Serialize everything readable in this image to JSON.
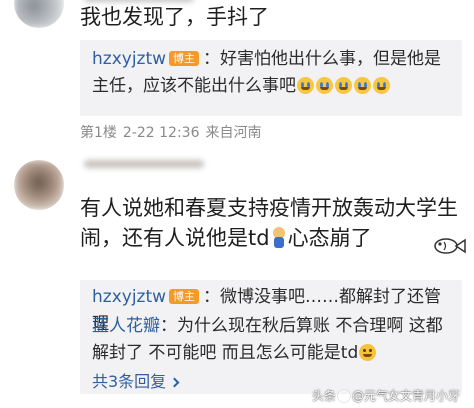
{
  "comment_1": {
    "text": "我也发现了，手抖了",
    "reply": {
      "username": "hzxyjztw",
      "badge": "博主",
      "text": "：好害怕他出什么事，但是他是主任，应该不能出什么事吧",
      "emojis": [
        "cry-emoji",
        "cry-emoji",
        "cry-emoji",
        "cry-emoji",
        "cry-emoji"
      ]
    },
    "meta": {
      "floor": "第1楼",
      "time": "2-22 12:36",
      "location": "来自河南"
    }
  },
  "comment_2": {
    "text_part1": "有人说她和春夏支持疫情开放轰动大学生闹，还有人说他是td",
    "text_part2": "心态崩了",
    "replies": [
      {
        "username": "hzxyjztw",
        "badge": "博主",
        "text": "：微博没事吧……都解封了还管理"
      },
      {
        "username": "蓝人花瓣",
        "text_part1": "：为什么现在秋后算账 不合理啊 这都解封了 不可能吧 而且怎么可能是td"
      }
    ],
    "replies_link": "共3条回复"
  },
  "watermark": {
    "prefix": "头条",
    "text": "@元气女文青月小牙"
  }
}
